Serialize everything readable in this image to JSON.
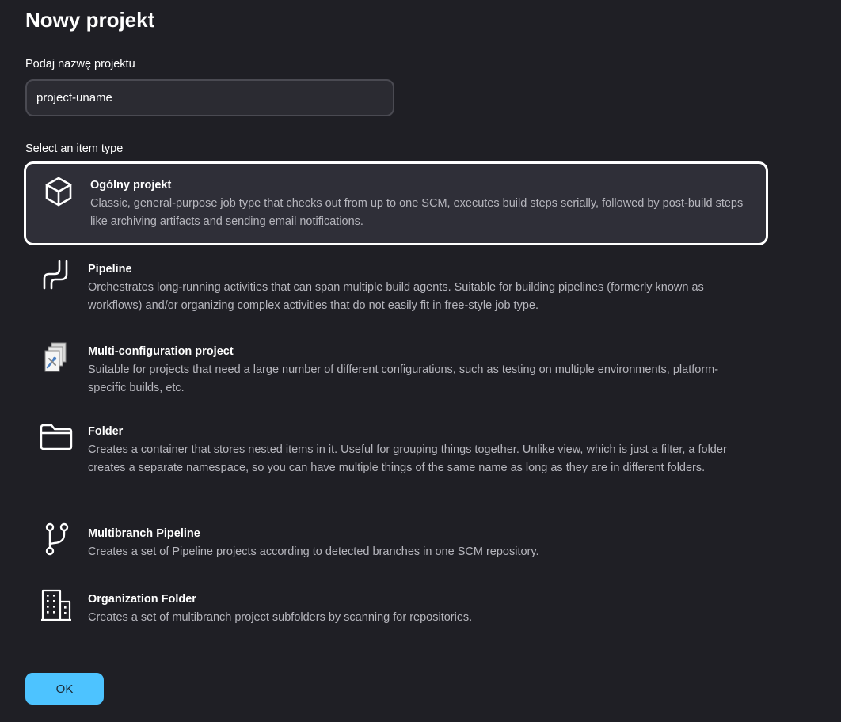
{
  "page": {
    "title": "Nowy projekt",
    "name_label": "Podaj nazwę projektu",
    "name_value": "project-uname",
    "type_label": "Select an item type",
    "ok_label": "OK"
  },
  "items": [
    {
      "icon": "package-icon",
      "name": "Ogólny projekt",
      "description": "Classic, general-purpose job type that checks out from up to one SCM, executes build steps serially, followed by post-build steps like archiving artifacts and sending email notifications.",
      "selected": true
    },
    {
      "icon": "pipeline-icon",
      "name": "Pipeline",
      "description": "Orchestrates long-running activities that can span multiple build agents. Suitable for building pipelines (formerly known as workflows) and/or organizing complex activities that do not easily fit in free-style job type.",
      "selected": false
    },
    {
      "icon": "multi-configuration-icon",
      "name": "Multi-configuration project",
      "description": "Suitable for projects that need a large number of different configurations, such as testing on multiple environments, platform-specific builds, etc.",
      "selected": false
    },
    {
      "icon": "folder-icon",
      "name": "Folder",
      "description": "Creates a container that stores nested items in it. Useful for grouping things together. Unlike view, which is just a filter, a folder creates a separate namespace, so you can have multiple things of the same name as long as they are in different folders.",
      "selected": false
    },
    {
      "icon": "branch-icon",
      "name": "Multibranch Pipeline",
      "description": "Creates a set of Pipeline projects according to detected branches in one SCM repository.",
      "selected": false
    },
    {
      "icon": "building-icon",
      "name": "Organization Folder",
      "description": "Creates a set of multibranch project subfolders by scanning for repositories.",
      "selected": false
    }
  ],
  "colors": {
    "background": "#1f1f25",
    "accent": "#4dc3ff",
    "selected_bg": "#2f2f38",
    "muted_text": "#b6b6bd"
  }
}
